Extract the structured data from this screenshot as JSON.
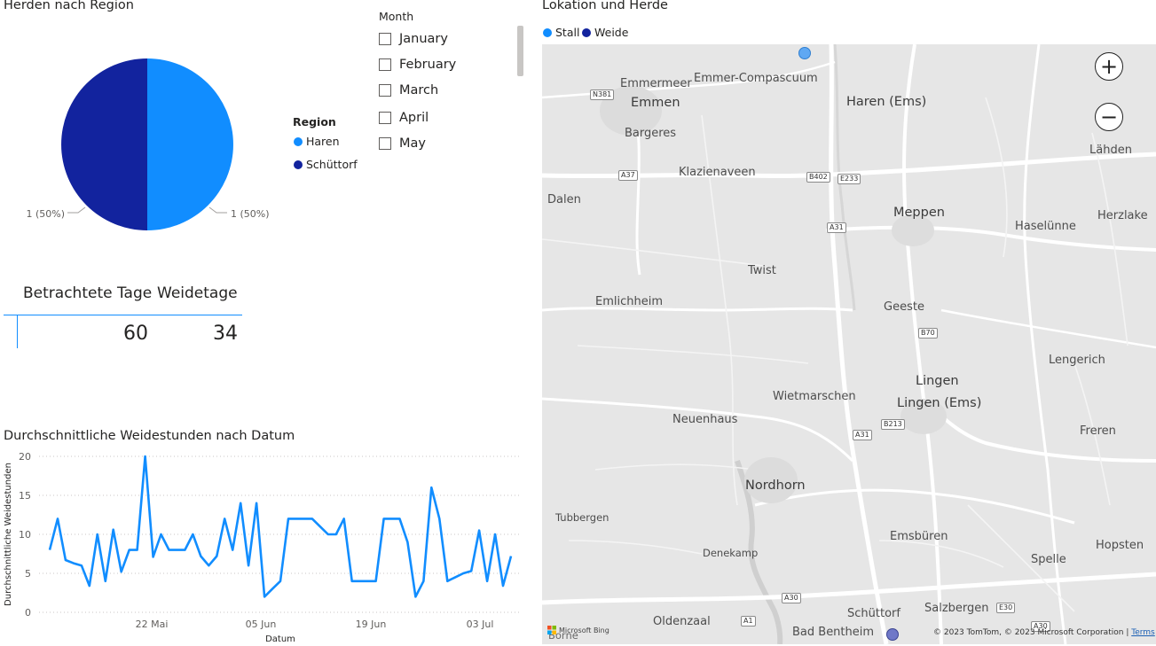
{
  "pie": {
    "title": "Herden nach Region",
    "legend_title": "Region",
    "legend": [
      {
        "label": "Haren",
        "color": "#118DFF"
      },
      {
        "label": "Schüttorf",
        "color": "#12239E"
      }
    ],
    "slices": [
      {
        "region": "Haren",
        "value": 1,
        "label": "1 (50%)",
        "color": "#118DFF"
      },
      {
        "region": "Schüttorf",
        "value": 1,
        "label": "1 (50%)",
        "color": "#12239E"
      }
    ]
  },
  "slicer": {
    "header": "Month",
    "items": [
      "January",
      "February",
      "March",
      "April",
      "May"
    ]
  },
  "table": {
    "columns": [
      "Betrachtete Tage",
      "Weidetage"
    ],
    "values": [
      "60",
      "34"
    ]
  },
  "line": {
    "title": "Durchschnittliche Weidestunden nach Datum",
    "xlabel": "Datum",
    "ylabel": "Durchschnittliche Weidestunden"
  },
  "chart_data": {
    "type": "line",
    "title": "Durchschnittliche Weidestunden nach Datum",
    "xlabel": "Datum",
    "ylabel": "Durchschnittliche Weidestunden",
    "ylim": [
      0,
      20
    ],
    "yticks": [
      "0",
      "5",
      "10",
      "15",
      "20"
    ],
    "xticks": [
      "22 Mai",
      "05 Jun",
      "19 Jun",
      "03 Jul"
    ],
    "grid": true,
    "color": "#118DFF",
    "series": [
      {
        "values": [
          8,
          12,
          6.7,
          6.3,
          6,
          3.4,
          10,
          4,
          10.6,
          5.2,
          8,
          8,
          20,
          7.1,
          10,
          8,
          8,
          8,
          10,
          7.2,
          6,
          7.2,
          12,
          8,
          14,
          6,
          14,
          2,
          3,
          4,
          12,
          12,
          12,
          12,
          11,
          10,
          10,
          12,
          4,
          4,
          4,
          4,
          12,
          12,
          12,
          9,
          2,
          4,
          16,
          12,
          4,
          4.5,
          5,
          5.3,
          10.5,
          4,
          10,
          3.4,
          7.2
        ]
      }
    ]
  },
  "map": {
    "title": "Lokation und Herde",
    "legend": [
      {
        "label": "Stall",
        "color": "#118DFF"
      },
      {
        "label": "Weide",
        "color": "#12239E"
      }
    ],
    "places": [
      {
        "name": "Emmermeer",
        "size": "normal"
      },
      {
        "name": "Emmer-Compascuum",
        "size": "normal"
      },
      {
        "name": "Emmen",
        "size": "big"
      },
      {
        "name": "Haren (Ems)",
        "size": "big"
      },
      {
        "name": "Bargeres",
        "size": "normal"
      },
      {
        "name": "Lähden",
        "size": "normal"
      },
      {
        "name": "Klazienaveen",
        "size": "normal"
      },
      {
        "name": "Dalen",
        "size": "normal"
      },
      {
        "name": "Meppen",
        "size": "big"
      },
      {
        "name": "Herzlake",
        "size": "normal"
      },
      {
        "name": "Haselünne",
        "size": "normal"
      },
      {
        "name": "Twist",
        "size": "normal"
      },
      {
        "name": "Emlichheim",
        "size": "normal"
      },
      {
        "name": "Geeste",
        "size": "normal"
      },
      {
        "name": "Lengerich",
        "size": "normal"
      },
      {
        "name": "Lingen",
        "size": "big"
      },
      {
        "name": "Wietmarschen",
        "size": "normal"
      },
      {
        "name": "Lingen (Ems)",
        "size": "big"
      },
      {
        "name": "Neuenhaus",
        "size": "normal"
      },
      {
        "name": "Freren",
        "size": "normal"
      },
      {
        "name": "Nordhorn",
        "size": "big"
      },
      {
        "name": "Tubbergen",
        "size": "small"
      },
      {
        "name": "Emsbüren",
        "size": "normal"
      },
      {
        "name": "Hopsten",
        "size": "normal"
      },
      {
        "name": "Denekamp",
        "size": "small"
      },
      {
        "name": "Spelle",
        "size": "normal"
      },
      {
        "name": "Schüttorf",
        "size": "normal"
      },
      {
        "name": "Salzbergen",
        "size": "normal"
      },
      {
        "name": "Oldenzaal",
        "size": "normal"
      },
      {
        "name": "Bad Bentheim",
        "size": "normal"
      },
      {
        "name": "Borne",
        "size": "normal"
      }
    ],
    "shields": [
      "N381",
      "A37",
      "B402",
      "E233",
      "A31",
      "B70",
      "A31",
      "B213",
      "A30",
      "A1",
      "E30",
      "A30"
    ],
    "zoom_in": "+",
    "zoom_out": "−",
    "bing_logo": "Microsoft Bing",
    "attribution": "© 2023 TomTom, © 2023 Microsoft Corporation",
    "terms": "Terms"
  }
}
